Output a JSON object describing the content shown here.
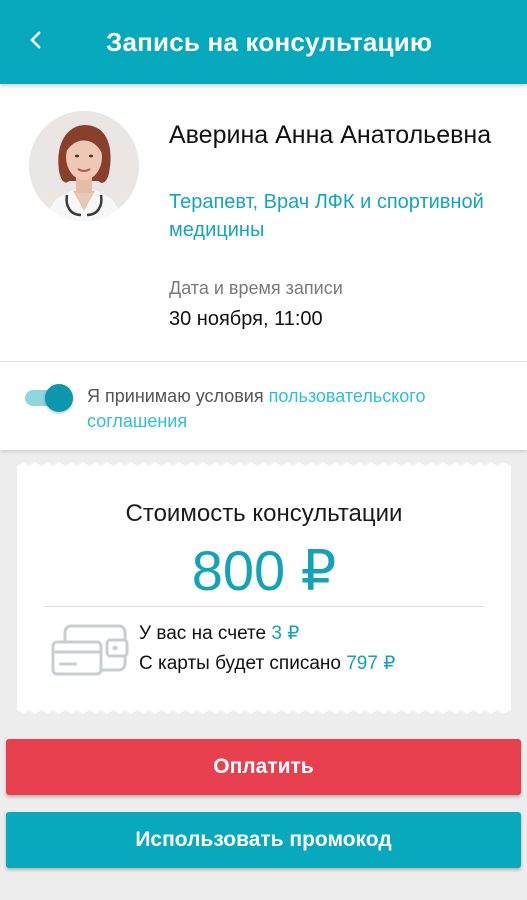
{
  "header": {
    "title": "Запись на консультацию",
    "back_icon": "chevron-left-icon",
    "background": "#06a8bb"
  },
  "doctor": {
    "name": "Аверина Анна Анатольевна",
    "specialty": "Терапевт, Врач ЛФК и спортивной медицины",
    "avatar_icon": "doctor-photo",
    "date_label": "Дата и время записи",
    "date_value": "30 ноября, 11:00"
  },
  "agreement": {
    "toggle_on": true,
    "text": "Я принимаю условия ",
    "link_text": "пользовательского соглашения",
    "link_color": "#2bc1d6"
  },
  "cost": {
    "title": "Стоимость консультации",
    "amount": "800 ₽",
    "wallet_icon": "wallet-icon",
    "balance_label": "У вас на счете ",
    "balance_value": "3 ₽",
    "charge_label": "С карты будет списано ",
    "charge_value": "797 ₽",
    "accent_color": "#11a3b8"
  },
  "actions": {
    "pay_label": "Оплатить",
    "pay_color": "#e8404f",
    "promo_label": "Использовать промокод",
    "promo_color": "#07a9bd"
  }
}
